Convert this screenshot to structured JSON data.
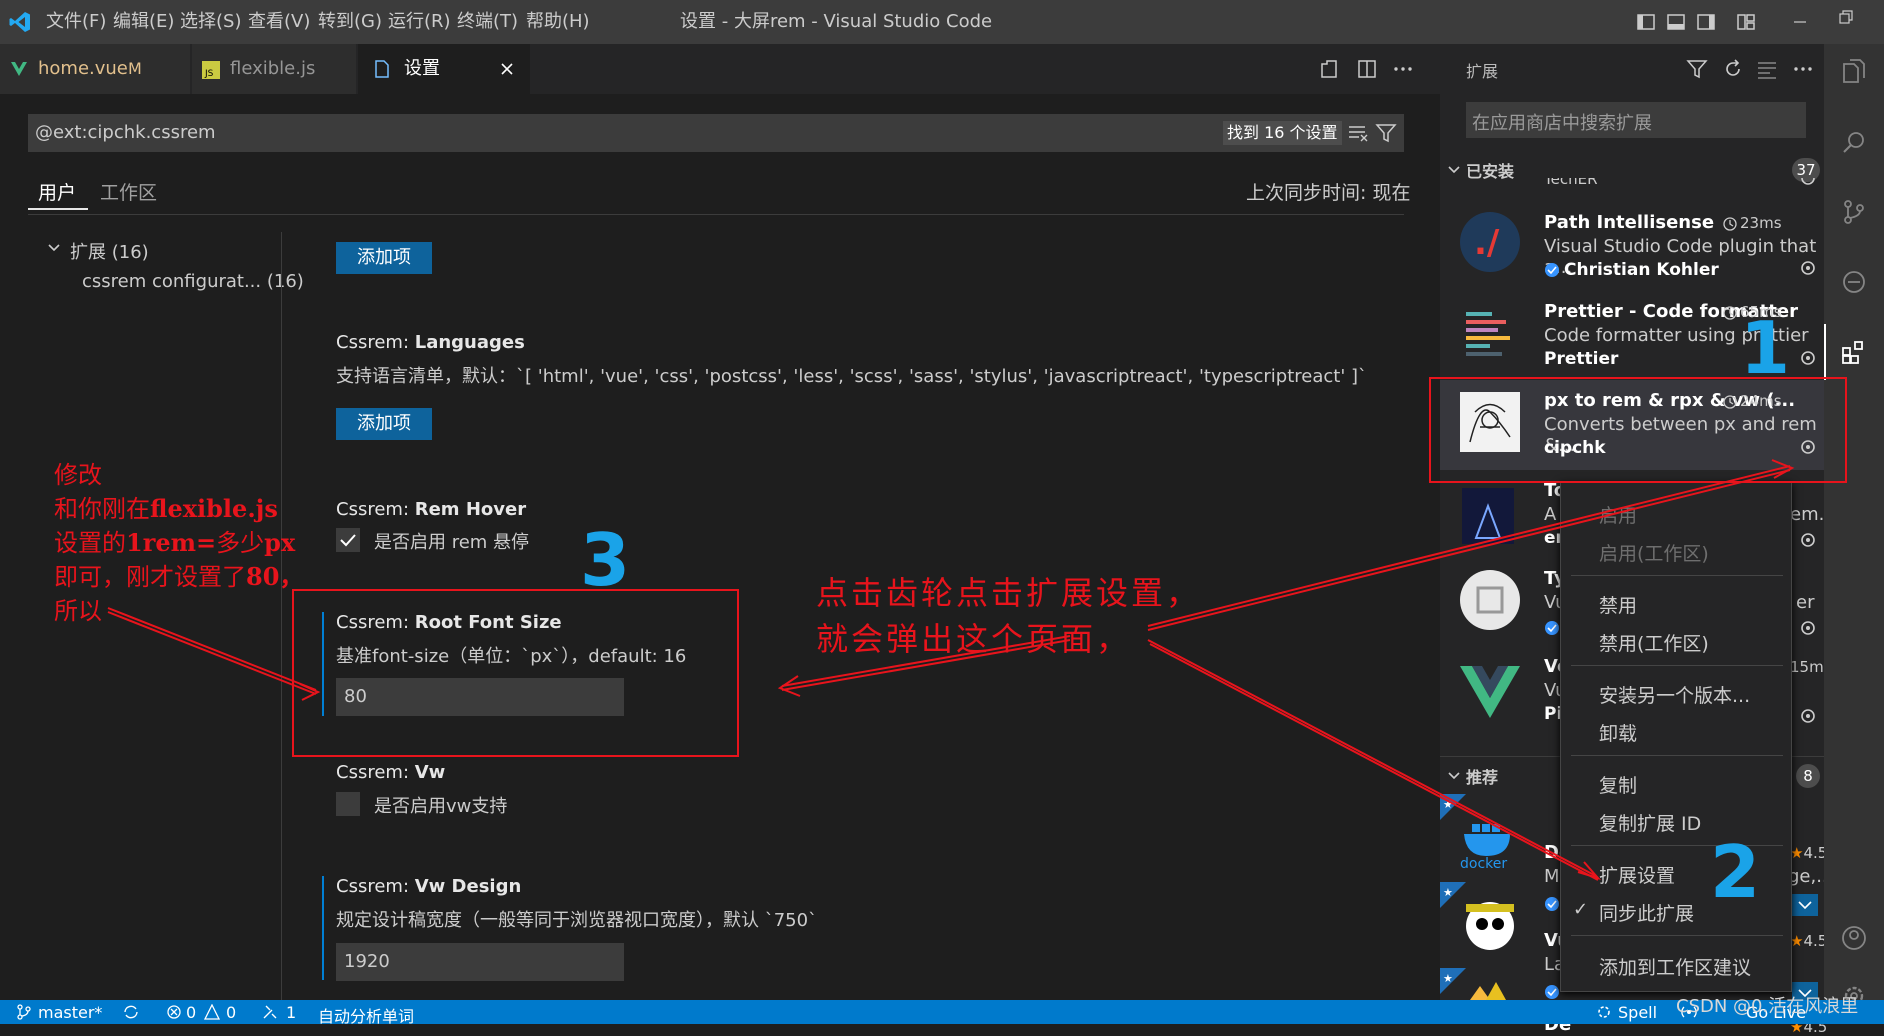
{
  "window": {
    "title": "设置 - 大屏rem - Visual Studio Code"
  },
  "menu": [
    "文件(F)",
    "编辑(E)",
    "选择(S)",
    "查看(V)",
    "转到(G)",
    "运行(R)",
    "终端(T)",
    "帮助(H)"
  ],
  "tabs": [
    {
      "label": "home.vue",
      "badge": "M"
    },
    {
      "label": "flexible.js"
    },
    {
      "label": "设置"
    }
  ],
  "settings": {
    "search_value": "@ext:cipchk.cssrem",
    "found": "找到 16 个设置",
    "scope_tabs": [
      "用户",
      "工作区"
    ],
    "last_sync": "上次同步时间: 现在",
    "toc": {
      "group": "扩展 (16)",
      "item": "cssrem configurat... (16)"
    },
    "add_item": "添加项",
    "languages": {
      "prefix": "Cssrem: ",
      "title": "Languages",
      "desc": "支持语言清单，默认：`[ 'html', 'vue', 'css', 'postcss', 'less', 'scss', 'sass', 'stylus', 'javascriptreact', 'typescriptreact' ]`"
    },
    "rem_hover": {
      "prefix": "Cssrem: ",
      "title": "Rem Hover",
      "desc": "是否启用 rem 悬停"
    },
    "root_font": {
      "prefix": "Cssrem: ",
      "title": "Root Font Size",
      "desc": "基准font-size（单位：`px`），default: 16",
      "value": "80"
    },
    "vw": {
      "prefix": "Cssrem: ",
      "title": "Vw",
      "desc": "是否启用vw支持"
    },
    "vw_design": {
      "prefix": "Cssrem: ",
      "title": "Vw Design",
      "desc": "规定设计稿宽度（一般等同于浏览器视口宽度），默认 `750`",
      "value": "1920"
    }
  },
  "sidebar": {
    "title": "扩展",
    "search_placeholder": "在应用商店中搜索扩展",
    "installed": "已安装",
    "installed_count": "37",
    "recommended": "推荐",
    "recommended_count": "8",
    "partial_top": "TechER",
    "extensions": [
      {
        "name": "Path Intellisense",
        "time": "23ms",
        "desc": "Visual Studio Code plugin that a...",
        "publisher": "Christian Kohler"
      },
      {
        "name": "Prettier - Code formatter",
        "time": "65ms",
        "desc": "Code formatter using prettier",
        "publisher": "Prettier"
      },
      {
        "name": "px to rem & rpx & vw (...",
        "time": "24ms",
        "desc": "Converts between px and rem &...",
        "publisher": "cipchk"
      },
      {
        "name": "To",
        "desc": "A",
        "publisher": "en",
        "tail": "em..."
      },
      {
        "name": "Ty",
        "desc": "Vu",
        "tail": "er"
      },
      {
        "name": "Ve",
        "desc": "Vu",
        "publisher": "Pi",
        "time": "15ms"
      },
      {
        "name": "Do",
        "desc": "M",
        "rating": "4.5",
        "tail": "ge,..."
      },
      {
        "name": "Vu",
        "desc": "La",
        "rating": "4.5"
      },
      {
        "name": "De",
        "rating": "4.5"
      }
    ]
  },
  "context_menu": {
    "items": [
      "启用",
      "启用(工作区)",
      "禁用",
      "禁用(工作区)",
      "安装另一个版本...",
      "卸载",
      "复制",
      "复制扩展 ID",
      "扩展设置",
      "同步此扩展",
      "添加到工作区建议"
    ],
    "check": "✓"
  },
  "annotations": {
    "left_note": [
      "修改",
      "和你刚在flexible.js",
      "设置的1rem=多少px",
      "即可，刚才设置了80，",
      "所以"
    ],
    "left_note_rich": {
      "a": "和你刚在",
      "b": "flexible.js",
      "c": "设置的",
      "d": "1rem=",
      "e": "多少",
      "f": "px",
      "g": "即可，刚才设置了",
      "h": "80，"
    },
    "center_note": [
      "点击齿轮点击扩展设置，",
      "就会弹出这个页面，"
    ],
    "num1": "1",
    "num2": "2",
    "num3": "3"
  },
  "statusbar": {
    "branch": "master*",
    "errors": "0",
    "warnings": "0",
    "ports": "1",
    "auto": "自动分析单词",
    "spell": "Spell",
    "golive": "Go Live",
    "watermark": "CSDN @0.活在风浪里"
  },
  "colors": {
    "accent": "#007acc",
    "button": "#0e639c",
    "annotation_red": "#e8141c",
    "annotation_blue": "#1aa3e8"
  }
}
